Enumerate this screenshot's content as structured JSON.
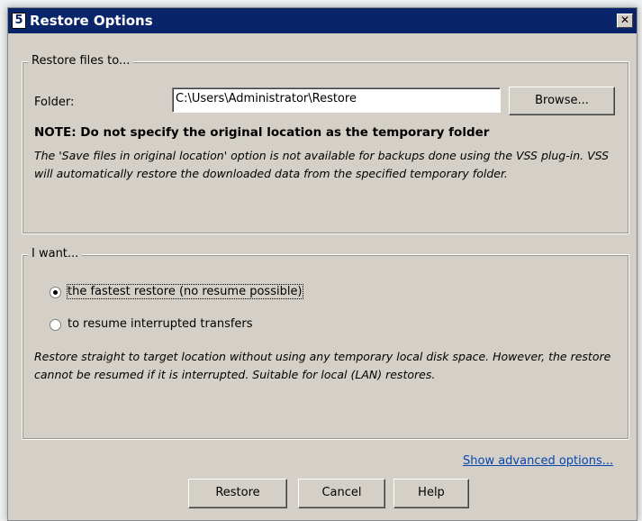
{
  "window": {
    "title": "Restore Options",
    "icon_char": "5"
  },
  "restore_group": {
    "legend": "Restore files to...",
    "folder_label": "Folder:",
    "folder_value": "C:\\Users\\Administrator\\Restore",
    "browse_label": "Browse...",
    "note": "NOTE: Do not specify the original location as the temporary folder",
    "description": "The 'Save files in original location' option is not available for backups done using the VSS plug-in. VSS will automatically restore the downloaded data from the specified temporary folder."
  },
  "want_group": {
    "legend": "I want...",
    "option_fastest": "the fastest restore (no resume possible)",
    "option_resume": "to resume interrupted transfers",
    "selected": "fastest",
    "description": "Restore straight to target location without using any temporary local disk space. However, the restore cannot be resumed if it is interrupted. Suitable for local (LAN) restores."
  },
  "advanced_link": "Show advanced options...",
  "buttons": {
    "restore": "Restore",
    "cancel": "Cancel",
    "help": "Help"
  }
}
